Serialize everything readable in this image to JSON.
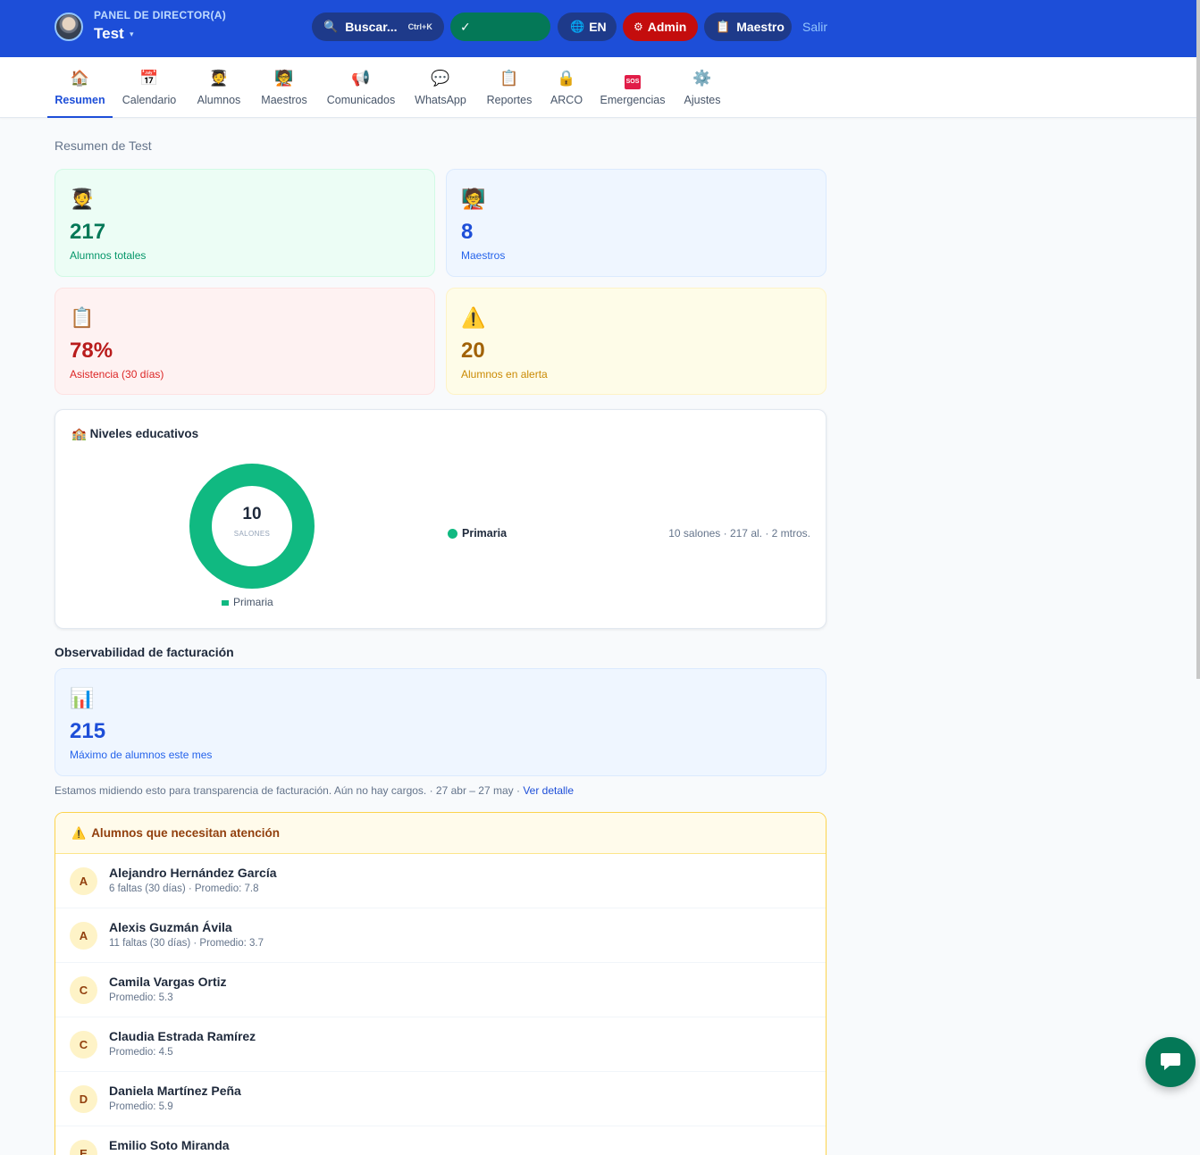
{
  "header": {
    "panel_label": "PANEL DE DIRECTOR(A)",
    "school_name": "Test",
    "caret": "▾",
    "search_label": "Buscar...",
    "search_shortcut": "Ctrl+K",
    "status_check": "✓",
    "lang_label": "EN",
    "admin_label": "Admin",
    "maestro_label": "Maestro",
    "logout_label": "Salir",
    "icons": {
      "search": "🔍",
      "globe": "🌐",
      "admin": "⚙",
      "maestro": "📋"
    }
  },
  "nav": {
    "tabs": [
      {
        "label": "Resumen",
        "icon": "🏠"
      },
      {
        "label": "Calendario",
        "icon": "📅"
      },
      {
        "label": "Alumnos",
        "icon": "🧑‍🎓"
      },
      {
        "label": "Maestros",
        "icon": "🧑‍🏫"
      },
      {
        "label": "Comunicados",
        "icon": "📢"
      },
      {
        "label": "WhatsApp",
        "icon": "💬"
      },
      {
        "label": "Reportes",
        "icon": "📋"
      },
      {
        "label": "ARCO",
        "icon": "🔒"
      },
      {
        "label": "Emergencias",
        "icon": "SOS"
      },
      {
        "label": "Ajustes",
        "icon": "⚙️"
      }
    ],
    "active": "Resumen"
  },
  "summary": {
    "subtitle": "Resumen de Test",
    "cards": [
      {
        "value": "217",
        "label": "Alumnos totales",
        "icon": "🧑‍🎓"
      },
      {
        "value": "8",
        "label": "Maestros",
        "icon": "🧑‍🏫"
      },
      {
        "value": "78%",
        "label": "Asistencia (30 días)",
        "icon": "📋"
      },
      {
        "value": "20",
        "label": "Alumnos en alerta",
        "icon": "⚠️"
      }
    ]
  },
  "levels": {
    "title": "Niveles educativos",
    "icon": "🏫",
    "donut_value": "10",
    "donut_label": "SALONES",
    "donut_legend": "Primaria",
    "items": [
      {
        "name": "Primaria",
        "stats": "10 salones · 217 al. · 2 mtros.",
        "color": "#10b981"
      }
    ]
  },
  "billing": {
    "title": "Observabilidad de facturación",
    "icon": "📊",
    "value": "215",
    "label": "Máximo de alumnos este mes",
    "note": "Estamos midiendo esto para transparencia de facturación. Aún no hay cargos. · 27 abr – 27 may ·",
    "link": "Ver detalle"
  },
  "alerts": {
    "title": "Alumnos que necesitan atención",
    "icon": "⚠️",
    "students": [
      {
        "initial": "A",
        "name": "Alejandro Hernández García",
        "detail": "6 faltas (30 días) · Promedio: 7.8"
      },
      {
        "initial": "A",
        "name": "Alexis Guzmán Ávila",
        "detail": "11 faltas (30 días) · Promedio: 3.7"
      },
      {
        "initial": "C",
        "name": "Camila Vargas Ortiz",
        "detail": "Promedio: 5.3"
      },
      {
        "initial": "C",
        "name": "Claudia Estrada Ramírez",
        "detail": "Promedio: 4.5"
      },
      {
        "initial": "D",
        "name": "Daniela Martínez Peña",
        "detail": "Promedio: 5.9"
      },
      {
        "initial": "E",
        "name": "Emilio Soto Miranda",
        "detail": ""
      }
    ]
  },
  "colors": {
    "primary": "#1d4ed8",
    "accent_green": "#10b981",
    "danger": "#c40d0d"
  }
}
